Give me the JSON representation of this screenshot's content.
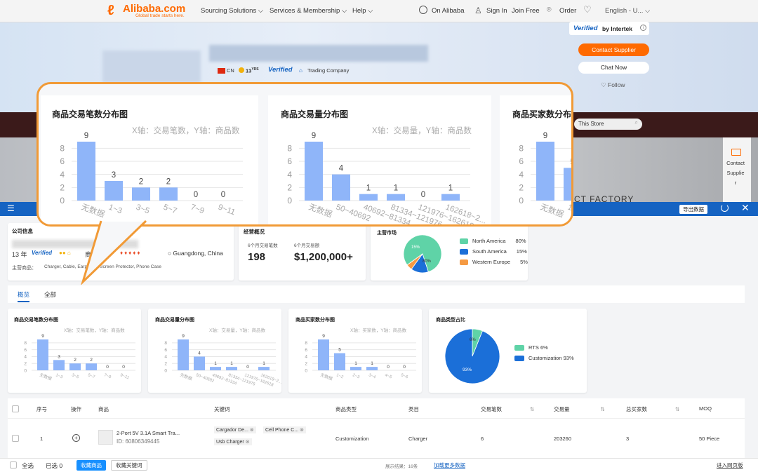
{
  "colors": {
    "brand": "#ff6a00",
    "blue": "#1563c2",
    "bar": "#8fb5f9",
    "callout": "#f19a36",
    "green": "#5fd3a7",
    "dark": "#1b6fd8",
    "orange": "#f59a43"
  },
  "nav": {
    "logo_name": "Alibaba.com",
    "logo_tag": "Global trade starts here.",
    "items": [
      "Sourcing Solutions",
      "Services & Membership",
      "Help"
    ],
    "on_alibaba": "On Alibaba",
    "sign_in": "Sign In",
    "join": "Join Free",
    "order": "Order",
    "language": "English - U..."
  },
  "supplier": {
    "country": "CN",
    "years_badge": "13",
    "years_unit": "YRS",
    "verified": "Verified",
    "type": "Trading Company",
    "verified_by": "Verified",
    "verified_by_org": "by Intertek",
    "contact_btn": "Contact Supplier",
    "chat_btn": "Chat Now",
    "follow": "Follow",
    "store_search": "This Store",
    "factory_text": "CT FACTORY",
    "side_contact": "Contact Supplier"
  },
  "panel": {
    "export_btn": "导出数据",
    "company_info": {
      "title": "公司信息",
      "years": "13 年",
      "verified": "Verified",
      "location": "Guangdong, China",
      "biz_label": "商",
      "main_products_label": "主营商品：",
      "main_products": "Charger, Cable, Earphone, Screen Protector, Phone Case"
    },
    "business": {
      "title": "经营概况",
      "trans_label": "6个月交易笔数",
      "trans_value": "198",
      "amount_label": "6个月交易额",
      "amount_value": "$1,200,000+"
    },
    "market": {
      "title": "主营市场",
      "legend": [
        {
          "name": "North America",
          "value": "80%"
        },
        {
          "name": "South America",
          "value": "15%"
        },
        {
          "name": "Western Europe",
          "value": "5%"
        }
      ],
      "slice_labels": [
        "15%",
        "80%"
      ]
    },
    "tabs": [
      "概览",
      "全部"
    ],
    "chart_titles": [
      "商品交易笔数分布图",
      "商品交易量分布图",
      "商品买家数分布图",
      "商品类型占比"
    ],
    "axis_notes": [
      "X轴：交易笔数，Y轴：商品数",
      "X轴：交易量，Y轴：商品数",
      "X轴：买家数，Y轴：商品数"
    ],
    "type_legend": [
      {
        "name": "RTS",
        "value": "6%"
      },
      {
        "name": "Customization",
        "value": "93%"
      }
    ],
    "type_slice_labels": [
      "6%",
      "93%"
    ]
  },
  "callout": {
    "titles": [
      "商品交易笔数分布图",
      "商品交易量分布图",
      "商品买家数分布"
    ],
    "axis_notes": [
      "X轴：交易笔数，Y轴：商品数",
      "X轴：交易量，Y轴：商品数"
    ]
  },
  "chart_data": [
    {
      "type": "bar",
      "title": "商品交易笔数分布图",
      "categories": [
        "无数据",
        "1~3",
        "3~5",
        "5~7",
        "7~9",
        "9~11"
      ],
      "values": [
        9,
        3,
        2,
        2,
        0,
        0
      ],
      "ylim": [
        0,
        9
      ],
      "yticks": [
        0,
        2,
        4,
        6,
        8
      ]
    },
    {
      "type": "bar",
      "title": "商品交易量分布图",
      "categories": [
        "无数据",
        "50~40692",
        "40692~81334",
        "81334~121976",
        "121976~162618",
        "162618~2..."
      ],
      "values": [
        9,
        4,
        1,
        1,
        0,
        1
      ],
      "ylim": [
        0,
        9
      ],
      "yticks": [
        0,
        2,
        4,
        6,
        8
      ]
    },
    {
      "type": "bar",
      "title": "商品买家数分布图",
      "categories": [
        "无数据",
        "1~2",
        "2~3",
        "3~4",
        "4~5",
        "5~6"
      ],
      "values": [
        9,
        5,
        1,
        1,
        0,
        0
      ],
      "ylim": [
        0,
        9
      ],
      "yticks": [
        0,
        2,
        4,
        6,
        8
      ]
    },
    {
      "type": "pie",
      "title": "主营市场",
      "labels": [
        "North America",
        "South America",
        "Western Europe"
      ],
      "values": [
        80,
        15,
        5
      ]
    },
    {
      "type": "pie",
      "title": "商品类型占比",
      "labels": [
        "RTS",
        "Customization"
      ],
      "values": [
        6,
        93
      ]
    }
  ],
  "table": {
    "headers": [
      "序号",
      "操作",
      "商品",
      "关键词",
      "商品类型",
      "类目",
      "交易笔数",
      "交易量",
      "总买家数",
      "MOQ"
    ],
    "rows": [
      {
        "index": "1",
        "product": "2-Port 5V 3.1A Smart Tra...",
        "id": "ID: 60806349445",
        "keywords": [
          "Cargador De...",
          "Cell Phone C...",
          "Usb Charger"
        ],
        "ptype": "Customization",
        "category": "Charger",
        "trans": "6",
        "volume": "203260",
        "buyers": "3",
        "moq": "50 Piece"
      }
    ]
  },
  "footer": {
    "select_all": "全选",
    "selected": "已选 0",
    "collect_products": "收藏商品",
    "collect_keywords": "收藏关键词",
    "result": "展示结果：16条",
    "load_more": "加载更多数据",
    "enter_page": "进入网页版"
  }
}
